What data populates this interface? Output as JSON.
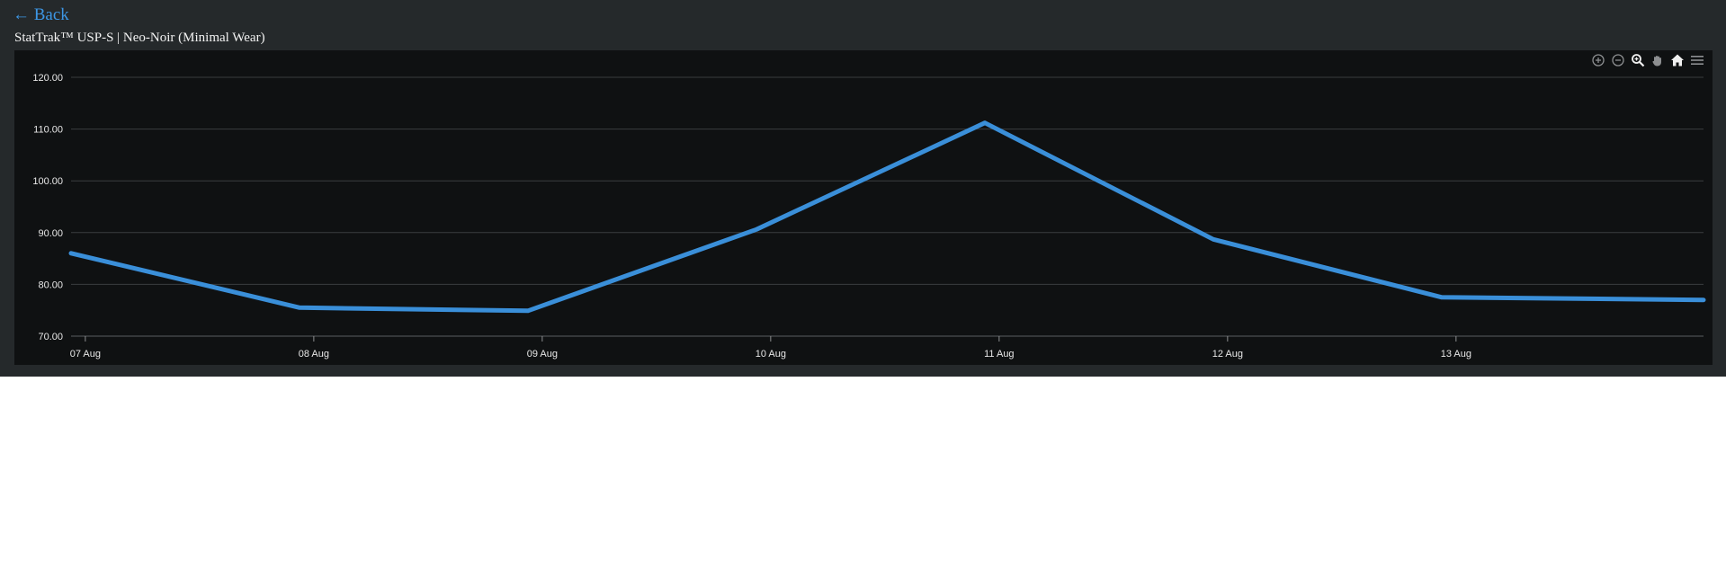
{
  "nav": {
    "back_label": "← Back"
  },
  "item": {
    "title": "StatTrak™ USP-S | Neo-Noir (Minimal Wear)"
  },
  "toolbar": {
    "icons": [
      "zoom-in-icon",
      "zoom-out-icon",
      "selection-zoom-icon",
      "pan-icon",
      "reset-zoom-home-icon",
      "menu-icon"
    ]
  },
  "colors": {
    "panel_bg": "#25292b",
    "chart_bg": "#0f1112",
    "line": "#3a8fd9",
    "link": "#3d97e6",
    "grid": "#3a3d3f"
  },
  "chart_data": {
    "type": "line",
    "title": "",
    "xlabel": "",
    "ylabel": "",
    "y_ticks": [
      "70.00",
      "80.00",
      "90.00",
      "100.00",
      "110.00",
      "120.00"
    ],
    "ylim": [
      70,
      120
    ],
    "x_ticks": [
      "07 Aug",
      "08 Aug",
      "09 Aug",
      "10 Aug",
      "11 Aug",
      "12 Aug",
      "13 Aug"
    ],
    "xlim": [
      "2024-08-06 22:30",
      "2024-08-14 02:00"
    ],
    "grid": true,
    "legend": "none",
    "series": [
      {
        "points": [
          {
            "x": "2024-08-06 22:30",
            "y": 86.0
          },
          {
            "x": "2024-08-07 22:30",
            "y": 75.5
          },
          {
            "x": "2024-08-08 22:30",
            "y": 74.9
          },
          {
            "x": "2024-08-09 22:30",
            "y": 90.6
          },
          {
            "x": "2024-08-10 22:30",
            "y": 111.2
          },
          {
            "x": "2024-08-11 22:30",
            "y": 88.7
          },
          {
            "x": "2024-08-12 22:30",
            "y": 77.5
          },
          {
            "x": "2024-08-14 02:00",
            "y": 77.0
          }
        ]
      }
    ]
  }
}
